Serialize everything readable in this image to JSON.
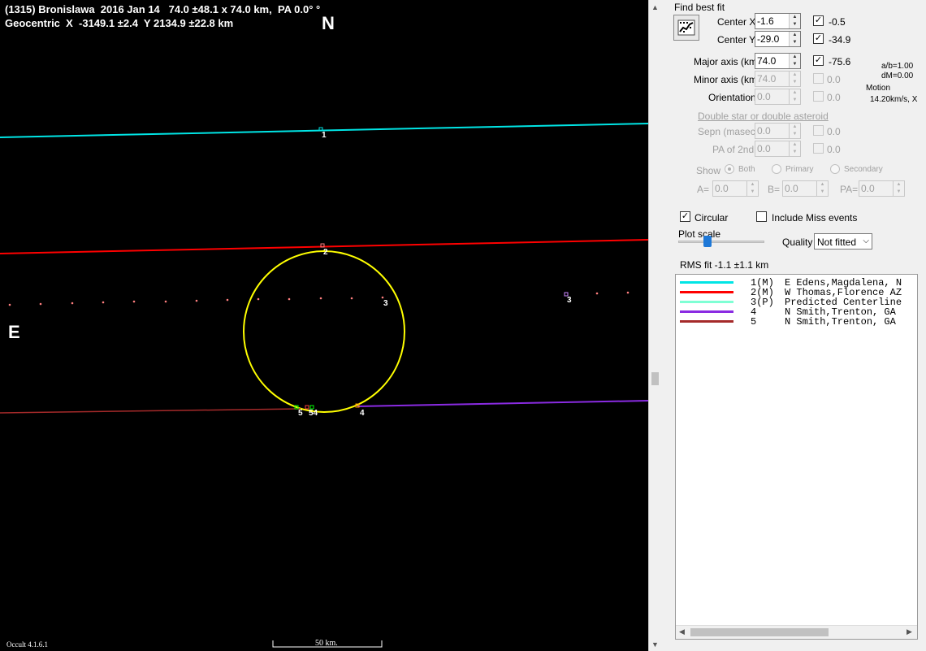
{
  "plot": {
    "header_line1": "(1315) Bronislawa  2016 Jan 14   74.0 ±48.1 x 74.0 km,  PA 0.0° °",
    "header_line2": "Geocentric  X  -3149.1 ±2.4  Y 2134.9 ±22.8 km",
    "north_label": "N",
    "east_label": "E",
    "version": "Occult 4.1.6.1",
    "scale_label": "50 km.",
    "chord_labels": {
      "c1": "1",
      "c2": "2",
      "c3a": "3",
      "c3b": "3",
      "c4": "4",
      "c5": "5",
      "c54": "54"
    },
    "colors": {
      "cyan": "#00e5e5",
      "red": "#ff0000",
      "yellow": "#ffff00",
      "purple": "#8a2be2",
      "darkred": "#a52a2a",
      "predicted": "#ff7f7f"
    }
  },
  "panel": {
    "find_best_fit": "Find best fit",
    "center_x_label": "Center X",
    "center_x_value": "-1.6",
    "center_x_check": true,
    "center_x_fit": "-0.5",
    "center_y_label": "Center Y",
    "center_y_value": "-29.0",
    "center_y_check": true,
    "center_y_fit": "-34.9",
    "major_label": "Major axis (km)",
    "major_value": "74.0",
    "major_check": true,
    "major_fit": "-75.6",
    "minor_label": "Minor axis (km)",
    "minor_value": "74.0",
    "minor_fit": "0.0",
    "orient_label": "Orientation",
    "orient_value": "0.0",
    "orient_fit": "0.0",
    "ab_ratio": "a/b=1.00",
    "dm": "dM=0.00",
    "motion_label": "Motion",
    "motion_value": "14.20km/s, X",
    "double_star_link": "Double star  or  double asteroid",
    "sepn_label": "Sepn (masec)",
    "sepn_value": "0.0",
    "sepn_fit": "0.0",
    "pa2_label": "PA of 2nd",
    "pa2_value": "0.0",
    "pa2_fit": "0.0",
    "show_label": "Show",
    "show_both": "Both",
    "show_primary": "Primary",
    "show_secondary": "Secondary",
    "a_label": "A=",
    "a_value": "0.0",
    "b_label": "B=",
    "b_value": "0.0",
    "pa_label": "PA=",
    "pa_value": "0.0",
    "circular_label": "Circular",
    "circular_checked": true,
    "miss_label": "Include Miss events",
    "miss_checked": false,
    "plot_scale_label": "Plot scale",
    "quality_label": "Quality",
    "quality_value": "Not fitted",
    "rms_label": "RMS fit -1.1 ±1.1 km"
  },
  "legend": [
    {
      "num": "1(M)",
      "text": "E Edens,Magdalena, N",
      "color": "#00e5e5"
    },
    {
      "num": "2(M)",
      "text": "W Thomas,Florence AZ",
      "color": "#ff0000"
    },
    {
      "num": "3(P)",
      "text": "Predicted Centerline",
      "color": "#7fffd4"
    },
    {
      "num": "4   ",
      "text": "N Smith,Trenton, GA",
      "color": "#8a2be2"
    },
    {
      "num": "5   ",
      "text": "N Smith,Trenton, GA",
      "color": "#a52a2a"
    }
  ]
}
